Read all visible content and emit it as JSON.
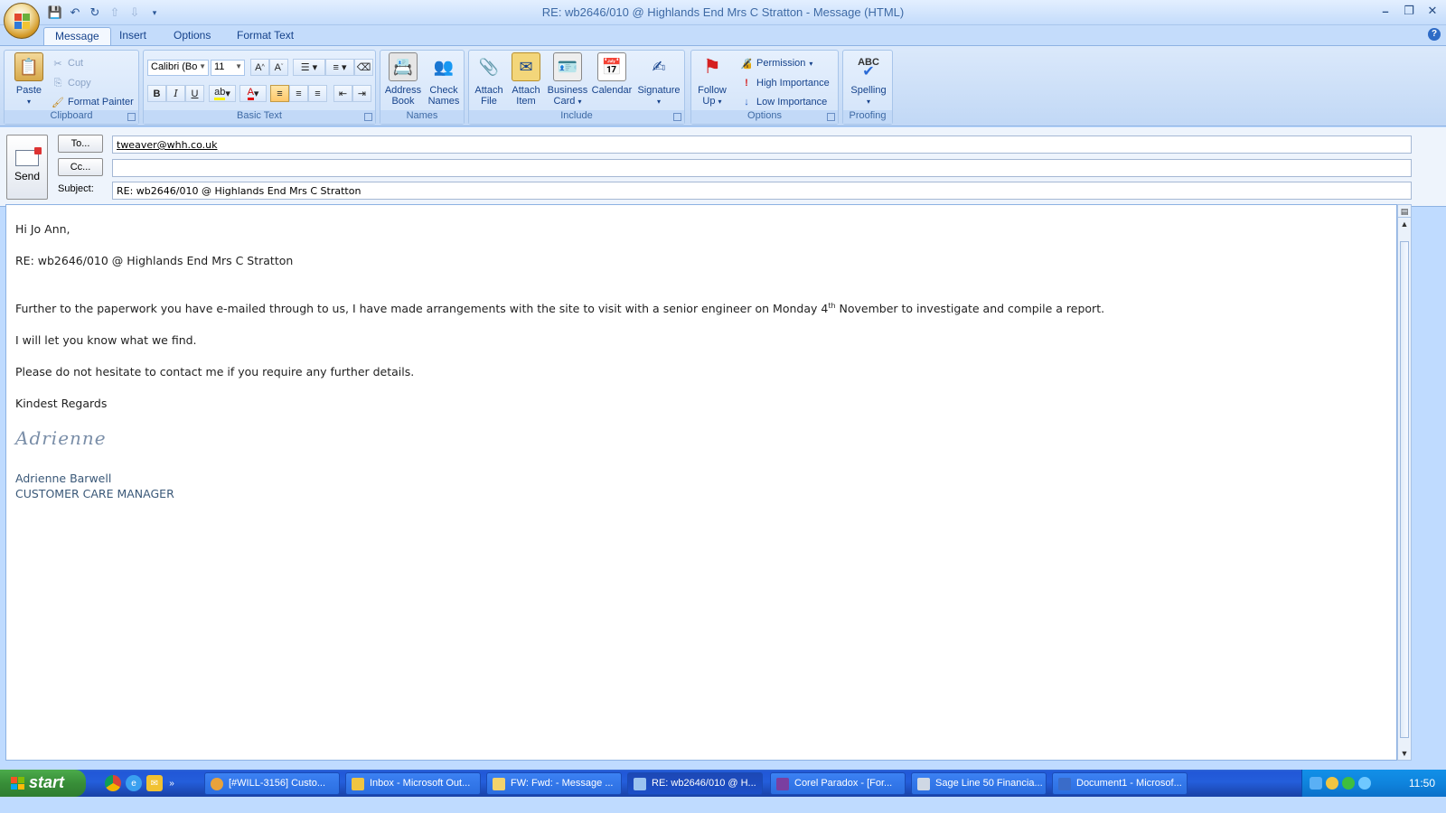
{
  "window": {
    "title": "RE: wb2646/010 @ Highlands End Mrs C Stratton - Message (HTML)",
    "controls": {
      "minimize": "–",
      "restore": "❐",
      "close": "✕"
    }
  },
  "tabs": [
    {
      "label": "Message",
      "active": true
    },
    {
      "label": "Insert"
    },
    {
      "label": "Options"
    },
    {
      "label": "Format Text"
    }
  ],
  "ribbon": {
    "clipboard": {
      "label": "Clipboard",
      "paste": "Paste",
      "cut": "Cut",
      "copy": "Copy",
      "format_painter": "Format Painter"
    },
    "basic_text": {
      "label": "Basic Text",
      "font": "Calibri (Bo",
      "size": "11",
      "bold": "B",
      "italic": "I",
      "underline": "U"
    },
    "names": {
      "label": "Names",
      "address_book_1": "Address",
      "address_book_2": "Book",
      "check_names_1": "Check",
      "check_names_2": "Names"
    },
    "include": {
      "label": "Include",
      "attach_file_1": "Attach",
      "attach_file_2": "File",
      "attach_item_1": "Attach",
      "attach_item_2": "Item",
      "business_card_1": "Business",
      "business_card_2": "Card",
      "calendar": "Calendar",
      "signature": "Signature"
    },
    "options": {
      "label": "Options",
      "follow_up_1": "Follow",
      "follow_up_2": "Up",
      "permission": "Permission",
      "high": "High Importance",
      "low": "Low Importance"
    },
    "proofing": {
      "label": "Proofing",
      "spelling": "Spelling",
      "abc": "ABC"
    }
  },
  "header": {
    "send": "Send",
    "to_button": "To...",
    "cc_button": "Cc...",
    "subject_label": "Subject:",
    "to_value": "tweaver@whh.co.uk",
    "cc_value": "",
    "subject_value": "RE: wb2646/010 @ Highlands End Mrs C Stratton"
  },
  "body": {
    "greeting": "Hi Jo Ann,",
    "ref": "RE: wb2646/010 @ Highlands End Mrs C Stratton",
    "para1_a": "Further to the paperwork you have e-mailed through to us, I have made arrangements with the site to visit with a senior engineer on Monday 4",
    "para1_sup": "th",
    "para1_b": " November to investigate and compile a report.",
    "para2": "I will let you know what we find.",
    "para3": "Please do not hesitate to contact me if you require any further details.",
    "closing": "Kindest Regards",
    "signature_script": "Adrienne",
    "sig_name": "Adrienne Barwell",
    "sig_title": "CUSTOMER CARE MANAGER"
  },
  "taskbar": {
    "start": "start",
    "quick_more": "»",
    "tasks": [
      {
        "label": "[#WILL-3156] Custo...",
        "color": "#e9a23b"
      },
      {
        "label": "Inbox - Microsoft Out...",
        "color": "#f0c541"
      },
      {
        "label": "FW: Fwd: - Message ...",
        "color": "#f3d36b"
      },
      {
        "label": "RE: wb2646/010 @ H...",
        "color": "#9bc3f0",
        "active": true
      },
      {
        "label": "Corel Paradox - [For...",
        "color": "#7a3fa0"
      },
      {
        "label": "Sage Line 50 Financia...",
        "color": "#cfd8e4"
      },
      {
        "label": "Document1 - Microsof...",
        "color": "#3a6cc9"
      }
    ],
    "clock": "11:50"
  }
}
